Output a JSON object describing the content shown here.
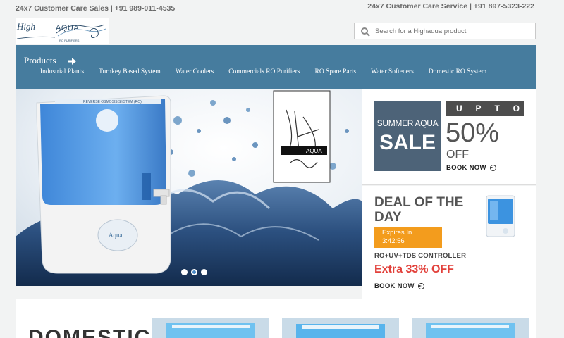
{
  "topbar": {
    "sales": "24x7 Customer Care Sales | +91 989-011-4535",
    "service": "24x7 Customer Care Service  | +91 897-5323-222"
  },
  "logo": {
    "text1": "High",
    "text2": "AQUA",
    "sub": "RO PURIFIERS"
  },
  "search": {
    "placeholder": "Search for a Highaqua product",
    "icon": "search-icon"
  },
  "nav": {
    "products_label": "Products",
    "items": [
      "Industrial Plants",
      "Turnkey Based System",
      "Water Coolers",
      "Commercials RO Purifiers",
      "RO Spare Parts",
      "Water Softeners",
      "Domestic RO System"
    ],
    "bg_color": "#467c9e"
  },
  "hero": {
    "slides": 3,
    "active_slide": 2,
    "panel_text": "REVERSE OSMOSIS SYSTEM (RO)",
    "logo_text": "AQUA"
  },
  "promo": {
    "sale_line1": "SUMMER AQUA",
    "sale_line2": "SALE",
    "upto": [
      "U",
      "P",
      "T",
      "O"
    ],
    "percent": "50%",
    "off": "OFF",
    "book_now": "BOOK NOW"
  },
  "deal": {
    "title": "DEAL OF THE DAY",
    "expires_label": "Expires In",
    "expires_time": "3:42:56",
    "product": "RO+UV+TDS CONTROLLER",
    "discount": "Extra 33% OFF",
    "book_now": "BOOK NOW",
    "accent_color": "#f39c1d",
    "discount_color": "#e2413b"
  },
  "bottom": {
    "heading": "DOMESTIC"
  }
}
